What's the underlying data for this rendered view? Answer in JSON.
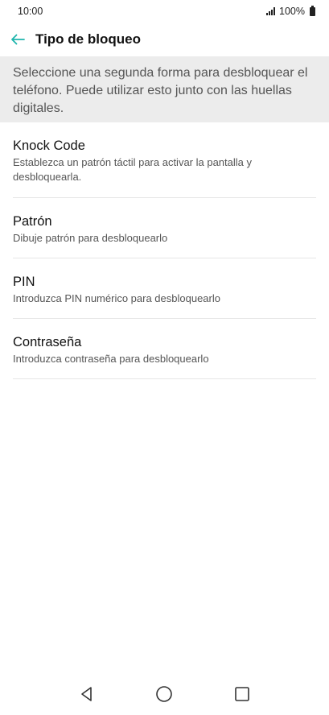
{
  "status_bar": {
    "time": "10:00",
    "battery": "100%"
  },
  "app_bar": {
    "title": "Tipo de bloqueo"
  },
  "info_banner": {
    "text": "Seleccione una segunda forma para desbloquear el teléfono. Puede utilizar esto junto con las huellas digitales."
  },
  "options": [
    {
      "title": "Knock Code",
      "description": "Establezca un patrón táctil para activar la pantalla y desbloquearla."
    },
    {
      "title": "Patrón",
      "description": "Dibuje patrón para desbloquearlo"
    },
    {
      "title": "PIN",
      "description": "Introduzca PIN numérico para desbloquearlo"
    },
    {
      "title": "Contraseña",
      "description": "Introduzca contraseña para desbloquearlo"
    }
  ],
  "colors": {
    "accent": "#1fb5ad",
    "banner_bg": "#ececec"
  }
}
